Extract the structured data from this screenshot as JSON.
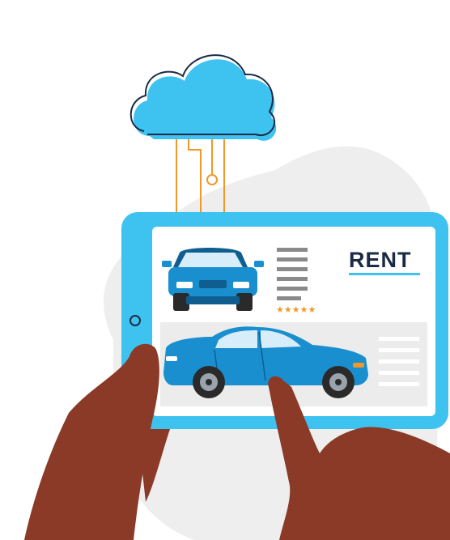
{
  "listing": {
    "label": "RENT",
    "rating": 5,
    "rating_text": "★★★★★"
  },
  "colors": {
    "cloud": "#3ec2f0",
    "cloud_outline": "#1b2b44",
    "circuit": "#f0982a",
    "tablet": "#3ec2f0",
    "car": "#1a8fcf",
    "car_dark": "#0f5e8f",
    "skin": "#8a3a26",
    "blob": "#eeeeef",
    "panel": "#ececec",
    "text_lines": "#8a8a8a",
    "star": "#f0982a",
    "accent": "#3ec2f0"
  },
  "icons": [
    "cloud-icon",
    "car-front-icon",
    "car-side-icon",
    "star-icon"
  ]
}
